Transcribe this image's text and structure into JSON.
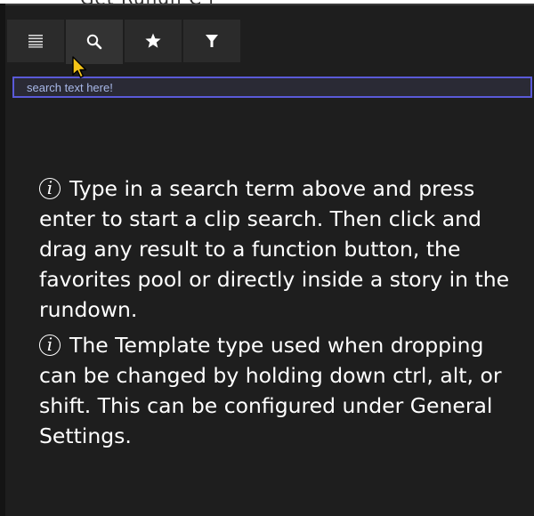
{
  "background_window": {
    "title_fragment": "Get Rundn C i"
  },
  "toolbar": {
    "buttons": [
      {
        "icon": "list-icon"
      },
      {
        "icon": "search-icon",
        "active": true
      },
      {
        "icon": "star-icon"
      },
      {
        "icon": "filter-icon"
      }
    ]
  },
  "search": {
    "placeholder": "search text here!",
    "value": "",
    "border_color": "#5a5ad8",
    "text_color": "#a8b8e8"
  },
  "help": {
    "paragraph_1": "Type in a search term above and press enter to start a clip search. Then click and drag any result to a function button, the favorites pool or directly inside a story in the rundown.",
    "paragraph_2": "The Template type used when dropping can be changed by holding down ctrl, alt, or shift. This can be configured under General Settings.",
    "info_glyph": "i"
  },
  "colors": {
    "panel_bg": "#1e1e1e",
    "button_bg": "#2b2b2b",
    "text": "#ffffff"
  }
}
